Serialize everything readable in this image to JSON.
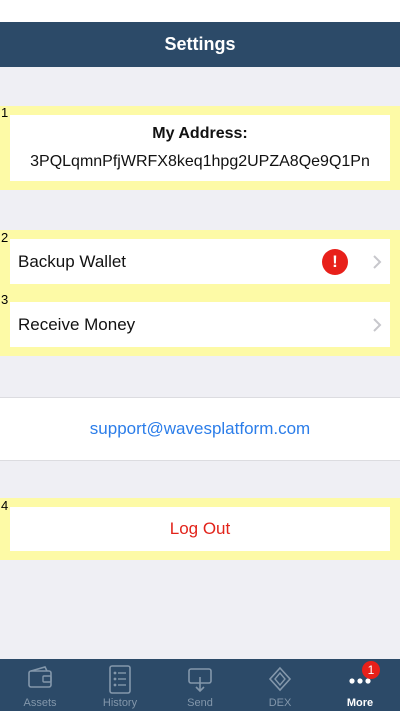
{
  "nav": {
    "title": "Settings"
  },
  "markers": [
    "1",
    "2",
    "3",
    "4"
  ],
  "address": {
    "title": "My Address:",
    "value": "3PQLqmnPfjWRFX8keq1hpg2UPZA8Qe9Q1Pn"
  },
  "rows": [
    {
      "label": "Backup Wallet",
      "alert": "!"
    },
    {
      "label": "Receive Money"
    }
  ],
  "support": {
    "email": "support@wavesplatform.com"
  },
  "logout": {
    "label": "Log Out"
  },
  "tabs": [
    {
      "label": "Assets",
      "icon": "wallet-icon"
    },
    {
      "label": "History",
      "icon": "list-icon"
    },
    {
      "label": "Send",
      "icon": "send-icon"
    },
    {
      "label": "DEX",
      "icon": "dex-icon"
    },
    {
      "label": "More",
      "icon": "more-icon",
      "badge": "1",
      "active": true
    }
  ],
  "colors": {
    "navbar": "#2c4a68",
    "highlight": "#fdfaa6",
    "alert": "#e8201a",
    "link": "#2b7de9",
    "logout": "#e2231a"
  }
}
